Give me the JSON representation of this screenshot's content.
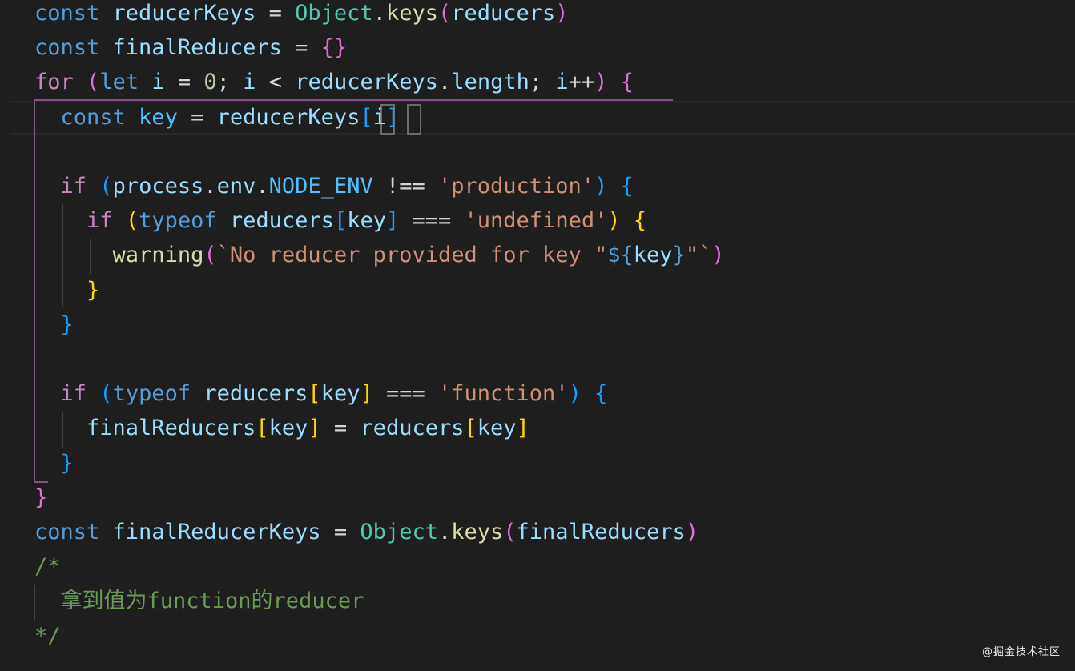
{
  "editor": {
    "lines": [
      [
        [
          "kw",
          "const"
        ],
        [
          "op",
          " "
        ],
        [
          "var",
          "reducerKeys"
        ],
        [
          "op",
          " = "
        ],
        [
          "cls",
          "Object"
        ],
        [
          "pun",
          "."
        ],
        [
          "fn",
          "keys"
        ],
        [
          "b2",
          "("
        ],
        [
          "var",
          "reducers"
        ],
        [
          "b2",
          ")"
        ]
      ],
      [
        [
          "kw",
          "const"
        ],
        [
          "op",
          " "
        ],
        [
          "var",
          "finalReducers"
        ],
        [
          "op",
          " = "
        ],
        [
          "b2",
          "{}"
        ]
      ],
      [
        [
          "ctl",
          "for"
        ],
        [
          "op",
          " "
        ],
        [
          "b2",
          "("
        ],
        [
          "kw",
          "let"
        ],
        [
          "op",
          " "
        ],
        [
          "var",
          "i"
        ],
        [
          "op",
          " = "
        ],
        [
          "num",
          "0"
        ],
        [
          "pun",
          "; "
        ],
        [
          "var",
          "i"
        ],
        [
          "op",
          " < "
        ],
        [
          "var",
          "reducerKeys"
        ],
        [
          "pun",
          "."
        ],
        [
          "var",
          "length"
        ],
        [
          "pun",
          "; "
        ],
        [
          "var",
          "i"
        ],
        [
          "op",
          "++"
        ],
        [
          "b2",
          ")"
        ],
        [
          "op",
          " "
        ],
        [
          "b2",
          "{"
        ]
      ],
      [
        [
          "op",
          "  "
        ],
        [
          "kw",
          "const"
        ],
        [
          "op",
          " "
        ],
        [
          "cst",
          "key"
        ],
        [
          "op",
          " = "
        ],
        [
          "var",
          "reducerKeys"
        ],
        [
          "b3",
          "["
        ],
        [
          "var",
          "i"
        ],
        [
          "b3",
          "]"
        ]
      ],
      [],
      [
        [
          "op",
          "  "
        ],
        [
          "ctl",
          "if"
        ],
        [
          "op",
          " "
        ],
        [
          "b3",
          "("
        ],
        [
          "var",
          "process"
        ],
        [
          "pun",
          "."
        ],
        [
          "var",
          "env"
        ],
        [
          "pun",
          "."
        ],
        [
          "cst",
          "NODE_ENV"
        ],
        [
          "op",
          " !== "
        ],
        [
          "str",
          "'production'"
        ],
        [
          "b3",
          ")"
        ],
        [
          "op",
          " "
        ],
        [
          "b3",
          "{"
        ]
      ],
      [
        [
          "op",
          "    "
        ],
        [
          "ctl",
          "if"
        ],
        [
          "op",
          " "
        ],
        [
          "b1",
          "("
        ],
        [
          "kw",
          "typeof"
        ],
        [
          "op",
          " "
        ],
        [
          "var",
          "reducers"
        ],
        [
          "b3",
          "["
        ],
        [
          "var",
          "key"
        ],
        [
          "b3",
          "]"
        ],
        [
          "op",
          " === "
        ],
        [
          "str",
          "'undefined'"
        ],
        [
          "b1",
          ")"
        ],
        [
          "op",
          " "
        ],
        [
          "b1",
          "{"
        ]
      ],
      [
        [
          "op",
          "      "
        ],
        [
          "fn",
          "warning"
        ],
        [
          "b2",
          "("
        ],
        [
          "str",
          "`No reducer provided for key \""
        ],
        [
          "kw",
          "${"
        ],
        [
          "var",
          "key"
        ],
        [
          "kw",
          "}"
        ],
        [
          "str",
          "\"`"
        ],
        [
          "b2",
          ")"
        ]
      ],
      [
        [
          "op",
          "    "
        ],
        [
          "b1",
          "}"
        ]
      ],
      [
        [
          "op",
          "  "
        ],
        [
          "b3",
          "}"
        ]
      ],
      [],
      [
        [
          "op",
          "  "
        ],
        [
          "ctl",
          "if"
        ],
        [
          "op",
          " "
        ],
        [
          "b3",
          "("
        ],
        [
          "kw",
          "typeof"
        ],
        [
          "op",
          " "
        ],
        [
          "var",
          "reducers"
        ],
        [
          "b1",
          "["
        ],
        [
          "var",
          "key"
        ],
        [
          "b1",
          "]"
        ],
        [
          "op",
          " === "
        ],
        [
          "str",
          "'function'"
        ],
        [
          "b3",
          ")"
        ],
        [
          "op",
          " "
        ],
        [
          "b3",
          "{"
        ]
      ],
      [
        [
          "op",
          "    "
        ],
        [
          "var",
          "finalReducers"
        ],
        [
          "b1",
          "["
        ],
        [
          "var",
          "key"
        ],
        [
          "b1",
          "]"
        ],
        [
          "op",
          " = "
        ],
        [
          "var",
          "reducers"
        ],
        [
          "b1",
          "["
        ],
        [
          "var",
          "key"
        ],
        [
          "b1",
          "]"
        ]
      ],
      [
        [
          "op",
          "  "
        ],
        [
          "b3",
          "}"
        ]
      ],
      [
        [
          "b2",
          "}"
        ]
      ],
      [
        [
          "kw",
          "const"
        ],
        [
          "op",
          " "
        ],
        [
          "var",
          "finalReducerKeys"
        ],
        [
          "op",
          " = "
        ],
        [
          "cls",
          "Object"
        ],
        [
          "pun",
          "."
        ],
        [
          "fn",
          "keys"
        ],
        [
          "b2",
          "("
        ],
        [
          "var",
          "finalReducers"
        ],
        [
          "b2",
          ")"
        ]
      ],
      [
        [
          "cmt",
          "/*"
        ]
      ],
      [
        [
          "cmt",
          "  拿到值为function的reducer"
        ]
      ],
      [
        [
          "cmt",
          "*/"
        ]
      ]
    ]
  },
  "watermark": "@掘金技术社区"
}
